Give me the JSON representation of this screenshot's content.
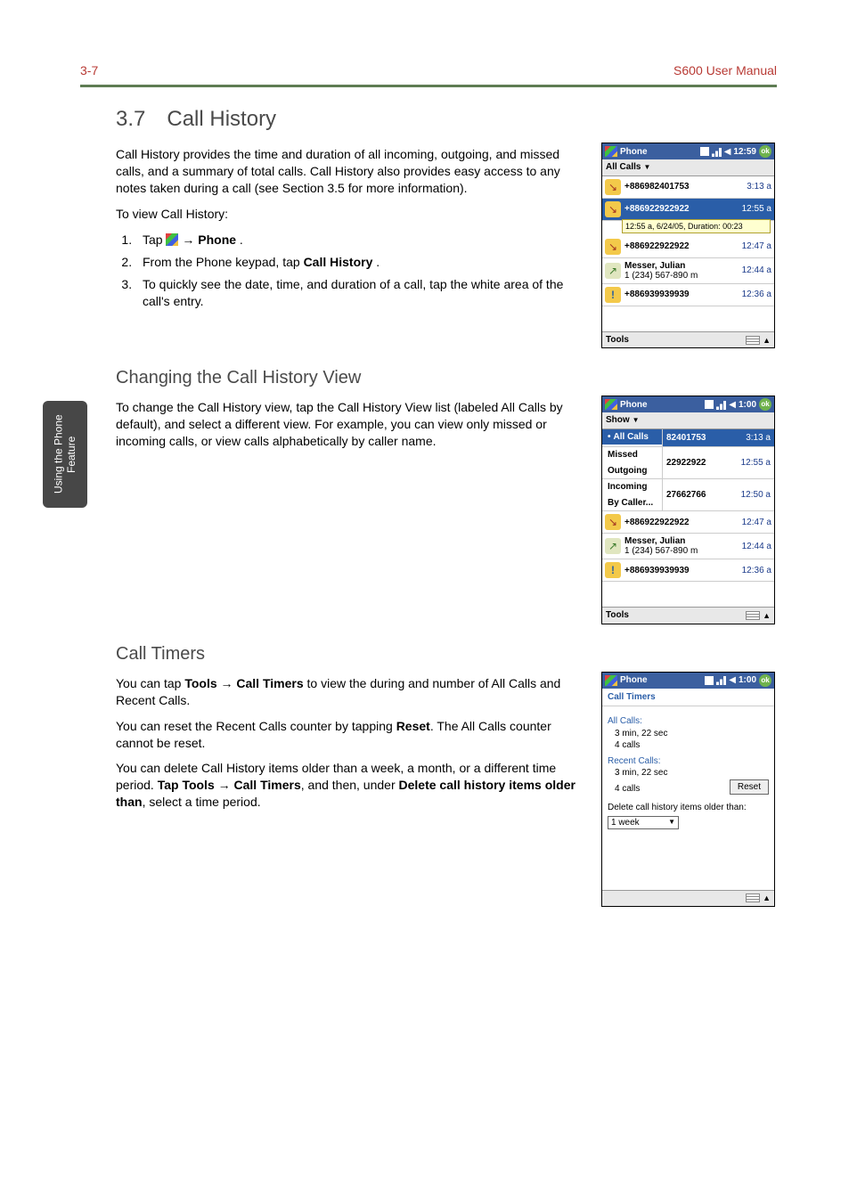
{
  "header": {
    "left": "3-7",
    "right": "S600 User Manual"
  },
  "sideTab": "Using the Phone\nFeature",
  "section": {
    "num": "3.7",
    "title": "Call History",
    "p1": "Call History provides the time and duration of all incoming, outgoing, and missed calls, and a summary of total calls. Call History also provides easy access to any notes taken during a call (see Section 3.5 for more information).",
    "p2": "To view Call History:",
    "steps": {
      "s1a": "Tap ",
      "s1b": " → ",
      "s1c": "Phone",
      "s1d": ".",
      "s2a": "From the Phone keypad, tap ",
      "s2b": "Call History",
      "s2c": ".",
      "s3": "To quickly see the date, time, and duration of a call, tap the white area of the call's entry."
    }
  },
  "sub1": {
    "title": "Changing the Call History View",
    "p": "To change the Call History view, tap the Call History View list (labeled All Calls by default), and select a different view. For example, you can view only missed or incoming calls, or view calls alphabetically by caller name."
  },
  "sub2": {
    "title": "Call Timers",
    "p1a": "You can tap ",
    "p1b": "Tools → Call Timers",
    "p1c": " to view the during and number of All Calls and Recent Calls.",
    "p2a": "You can reset the Recent Calls counter by tapping ",
    "p2b": "Reset",
    "p2c": ". The All Calls counter cannot be reset.",
    "p3a": "You can delete Call History items older than a week, a month, or a different time period. ",
    "p3b": "Tap Tools → Call Timers",
    "p3c": ", and then, under ",
    "p3d": "Delete call history items older than",
    "p3e": ", select a time period."
  },
  "shot1": {
    "title": "Phone",
    "clock": "12:59",
    "ok": "ok",
    "sub": "All Calls",
    "tooltip": "12:55 a, 6/24/05, Duration: 00:23",
    "rows": [
      {
        "icon": "in",
        "name": "+886982401753",
        "sub": "",
        "time": "3:13 a"
      },
      {
        "icon": "in",
        "name": "+886922922922",
        "sub": "",
        "time": "12:55 a",
        "sel": true
      },
      {
        "icon": "in",
        "name": "+886922922922",
        "sub": "",
        "time": "12:47 a"
      },
      {
        "icon": "out",
        "name": "Messer, Julian",
        "sub": "1 (234) 567-890 m",
        "time": "12:44 a"
      },
      {
        "icon": "miss",
        "name": "+886939939939",
        "sub": "",
        "time": "12:36 a"
      }
    ],
    "tools": "Tools"
  },
  "shot2": {
    "title": "Phone",
    "clock": "1:00",
    "ok": "ok",
    "sub": "Show",
    "menu": [
      "All Calls",
      "Missed",
      "Outgoing",
      "Incoming",
      "By Caller..."
    ],
    "partials": [
      {
        "num": "82401753",
        "time": "3:13 a",
        "sel": true
      },
      {
        "num": "22922922",
        "time": "12:55 a"
      },
      {
        "num": "27662766",
        "time": "12:50 a"
      }
    ],
    "rows": [
      {
        "icon": "in",
        "name": "+886922922922",
        "time": "12:47 a"
      },
      {
        "icon": "out",
        "name": "Messer, Julian",
        "sub": "1 (234) 567-890 m",
        "time": "12:44 a"
      },
      {
        "icon": "miss",
        "name": "+886939939939",
        "time": "12:36 a"
      }
    ],
    "tools": "Tools"
  },
  "shot3": {
    "title": "Phone",
    "clock": "1:00",
    "ok": "ok",
    "header": "Call Timers",
    "allLabel": "All Calls:",
    "allDur": "3 min, 22 sec",
    "allCount": "4 calls",
    "recentLabel": "Recent Calls:",
    "recentDur": "3 min, 22 sec",
    "recentCount": "4 calls",
    "reset": "Reset",
    "delLabel": "Delete call history items older than:",
    "delValue": "1 week"
  }
}
